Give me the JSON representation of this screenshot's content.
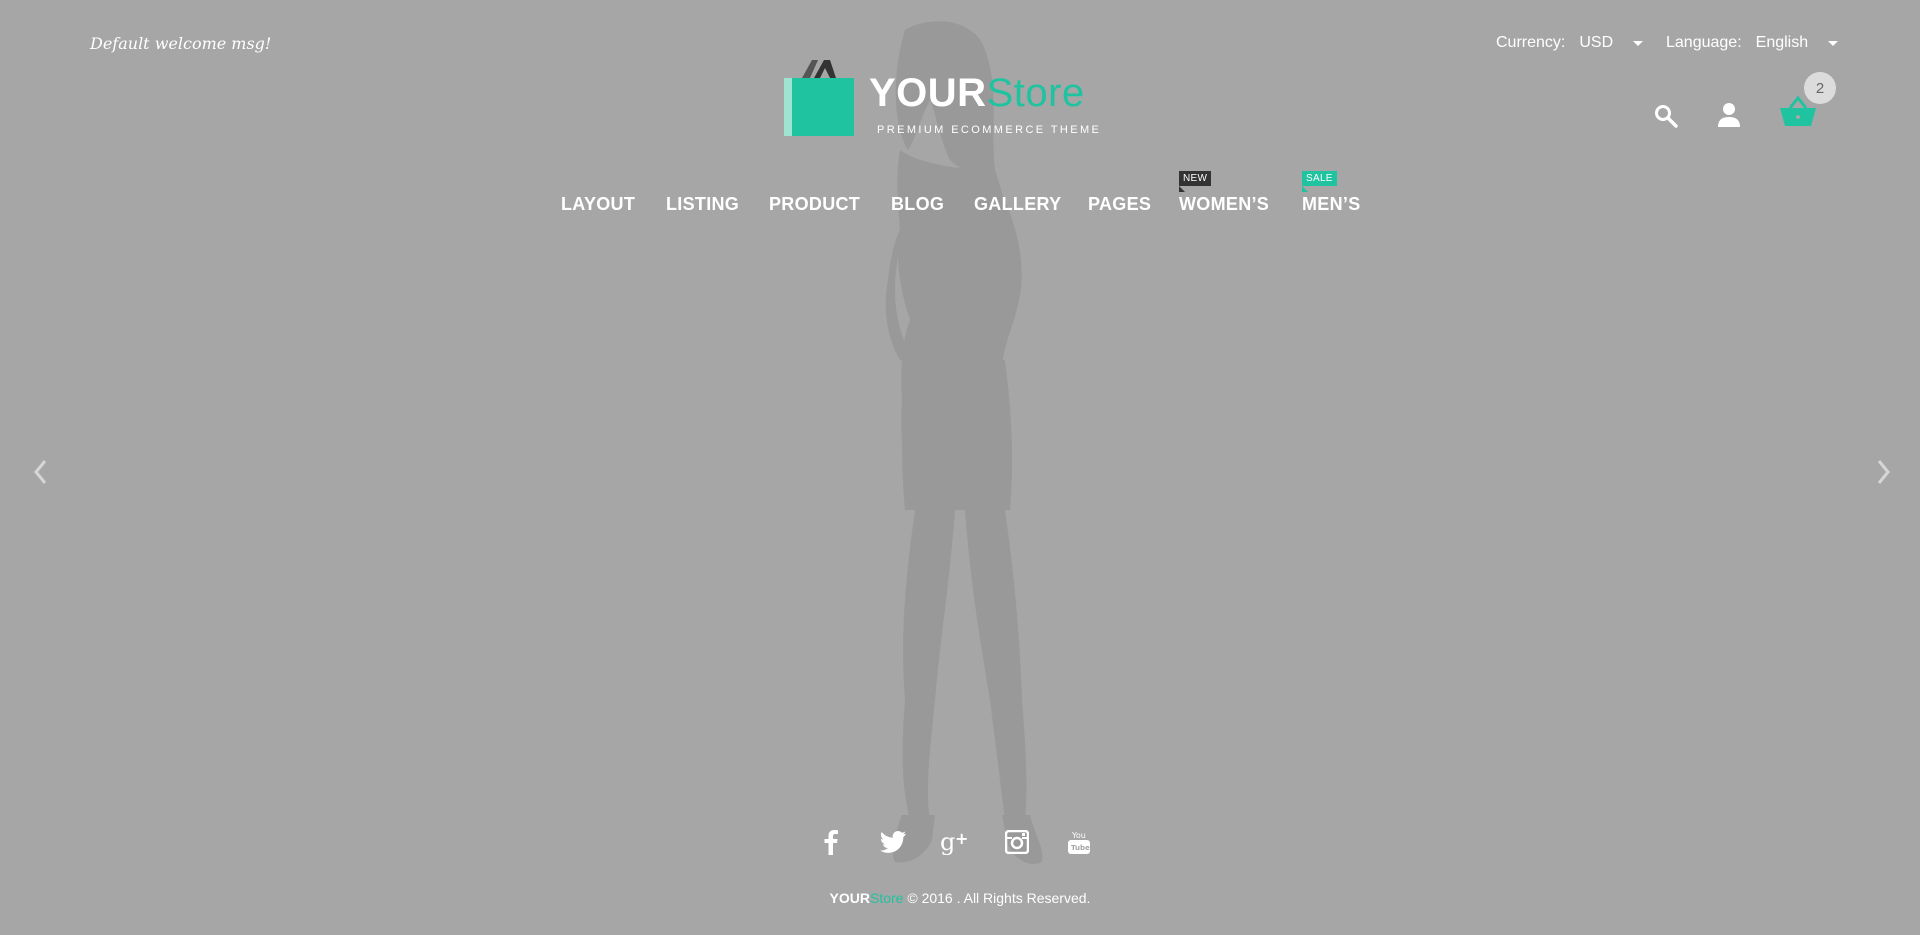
{
  "header": {
    "welcome_message": "Default welcome msg!",
    "currency": {
      "label": "Currency:",
      "value": "USD"
    },
    "language": {
      "label": "Language:",
      "value": "English"
    },
    "cart_count": "2"
  },
  "logo": {
    "word1": "YOUR",
    "word2": "Store",
    "tagline": "PREMIUM ECOMMERCE THEME"
  },
  "nav": {
    "items": [
      {
        "label": "LAYOUT"
      },
      {
        "label": "LISTING"
      },
      {
        "label": "PRODUCT"
      },
      {
        "label": "BLOG"
      },
      {
        "label": "GALLERY"
      },
      {
        "label": "PAGES"
      },
      {
        "label": "WOMEN’S",
        "badge": "NEW"
      },
      {
        "label": "MEN’S",
        "badge": "SALE"
      }
    ]
  },
  "social": [
    "facebook-icon",
    "twitter-icon",
    "google-plus-icon",
    "instagram-icon",
    "youtube-icon"
  ],
  "footer": {
    "brand1": "YOUR",
    "brand2": "Store",
    "copyright": " © 2016 . All Rights Reserved."
  },
  "colors": {
    "background": "#a6a6a6",
    "accent": "#1fc39f",
    "badge_new": "#333333",
    "text": "#ffffff"
  }
}
